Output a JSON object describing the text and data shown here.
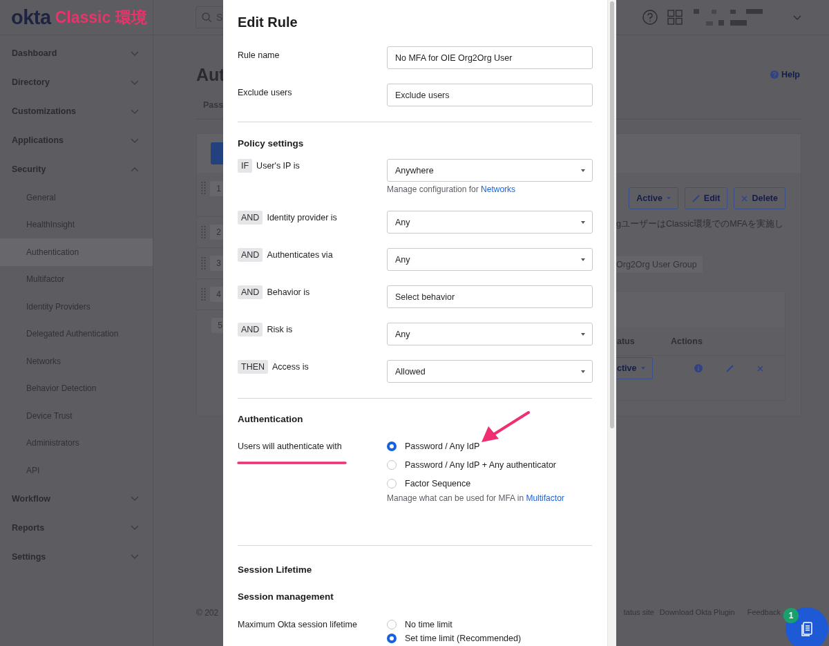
{
  "logo": {
    "brand": "okta",
    "label": "Classic 環境"
  },
  "header": {
    "search": {
      "placeholder": "S"
    }
  },
  "sidebar": {
    "items": [
      {
        "label": "Dashboard",
        "expanded": false
      },
      {
        "label": "Directory",
        "expanded": false
      },
      {
        "label": "Customizations",
        "expanded": false
      },
      {
        "label": "Applications",
        "expanded": false
      },
      {
        "label": "Security",
        "expanded": true,
        "children": [
          {
            "label": "General",
            "selected": false
          },
          {
            "label": "HealthInsight",
            "selected": false
          },
          {
            "label": "Authentication",
            "selected": true
          },
          {
            "label": "Multifactor",
            "selected": false
          },
          {
            "label": "Identity Providers",
            "selected": false
          },
          {
            "label": "Delegated Authentication",
            "selected": false
          },
          {
            "label": "Networks",
            "selected": false
          },
          {
            "label": "Behavior Detection",
            "selected": false
          },
          {
            "label": "Device Trust",
            "selected": false
          },
          {
            "label": "Administrators",
            "selected": false
          },
          {
            "label": "API",
            "selected": false
          }
        ]
      },
      {
        "label": "Workflow",
        "expanded": false
      },
      {
        "label": "Reports",
        "expanded": false
      },
      {
        "label": "Settings",
        "expanded": false
      }
    ]
  },
  "page": {
    "title": "Aut",
    "help": "Help",
    "tabs": [
      {
        "label": "Pass"
      }
    ],
    "policies": [
      {
        "number": "1",
        "draggable": true
      },
      {
        "number": "2",
        "draggable": true
      },
      {
        "number": "3",
        "draggable": true
      },
      {
        "number": "4",
        "draggable": true
      },
      {
        "number": "5",
        "draggable": false
      }
    ],
    "detail": {
      "status_button": "Active",
      "edit_button": "Edit",
      "delete_button": "Delete",
      "description": "gユーザーはClassic環境でのMFAを実施し",
      "group_tag": "Org2Org User Group",
      "table": {
        "columns": [
          "atus",
          "Actions"
        ],
        "rows": [
          {
            "status": "ctive"
          }
        ]
      }
    }
  },
  "footer": {
    "copyright": "© 202",
    "links": [
      "tatus site",
      "Download Okta Plugin",
      "Feedback"
    ]
  },
  "help_button": {
    "badge": "1"
  },
  "modal": {
    "title": "Edit Rule",
    "fields": [
      {
        "label": "Rule name",
        "kind": "text",
        "value": "No MFA for OIE Org2Org User"
      },
      {
        "label": "Exclude users",
        "kind": "text",
        "placeholder": "Exclude users"
      }
    ],
    "policy": {
      "heading": "Policy settings",
      "conditions": [
        {
          "operator": "IF",
          "label": "User's IP is",
          "kind": "select",
          "value": "Anywhere",
          "help": {
            "text": "Manage configuration for",
            "link": "Networks"
          }
        },
        {
          "operator": "AND",
          "label": "Identity provider is",
          "kind": "select",
          "value": "Any"
        },
        {
          "operator": "AND",
          "label": "Authenticates via",
          "kind": "select",
          "value": "Any"
        },
        {
          "operator": "AND",
          "label": "Behavior is",
          "kind": "text",
          "placeholder": "Select behavior"
        },
        {
          "operator": "AND",
          "label": "Risk is",
          "kind": "select",
          "value": "Any"
        },
        {
          "operator": "THEN",
          "label": "Access is",
          "kind": "select",
          "value": "Allowed"
        }
      ]
    },
    "authentication": {
      "heading": "Authentication",
      "label": "Users will authenticate with",
      "options": [
        {
          "label": "Password / Any IdP",
          "selected": true
        },
        {
          "label": "Password / Any IdP + Any authenticator",
          "selected": false
        },
        {
          "label": "Factor Sequence",
          "selected": false
        }
      ],
      "help": {
        "text": "Manage what can be used for MFA in",
        "link": "Multifactor"
      }
    },
    "session": {
      "heading": "Session Lifetime",
      "subheading": "Session management",
      "label": "Maximum Okta session lifetime",
      "options": [
        {
          "label": "No time limit",
          "selected": false
        },
        {
          "label": "Set time limit (Recommended)",
          "selected": true
        }
      ]
    }
  }
}
